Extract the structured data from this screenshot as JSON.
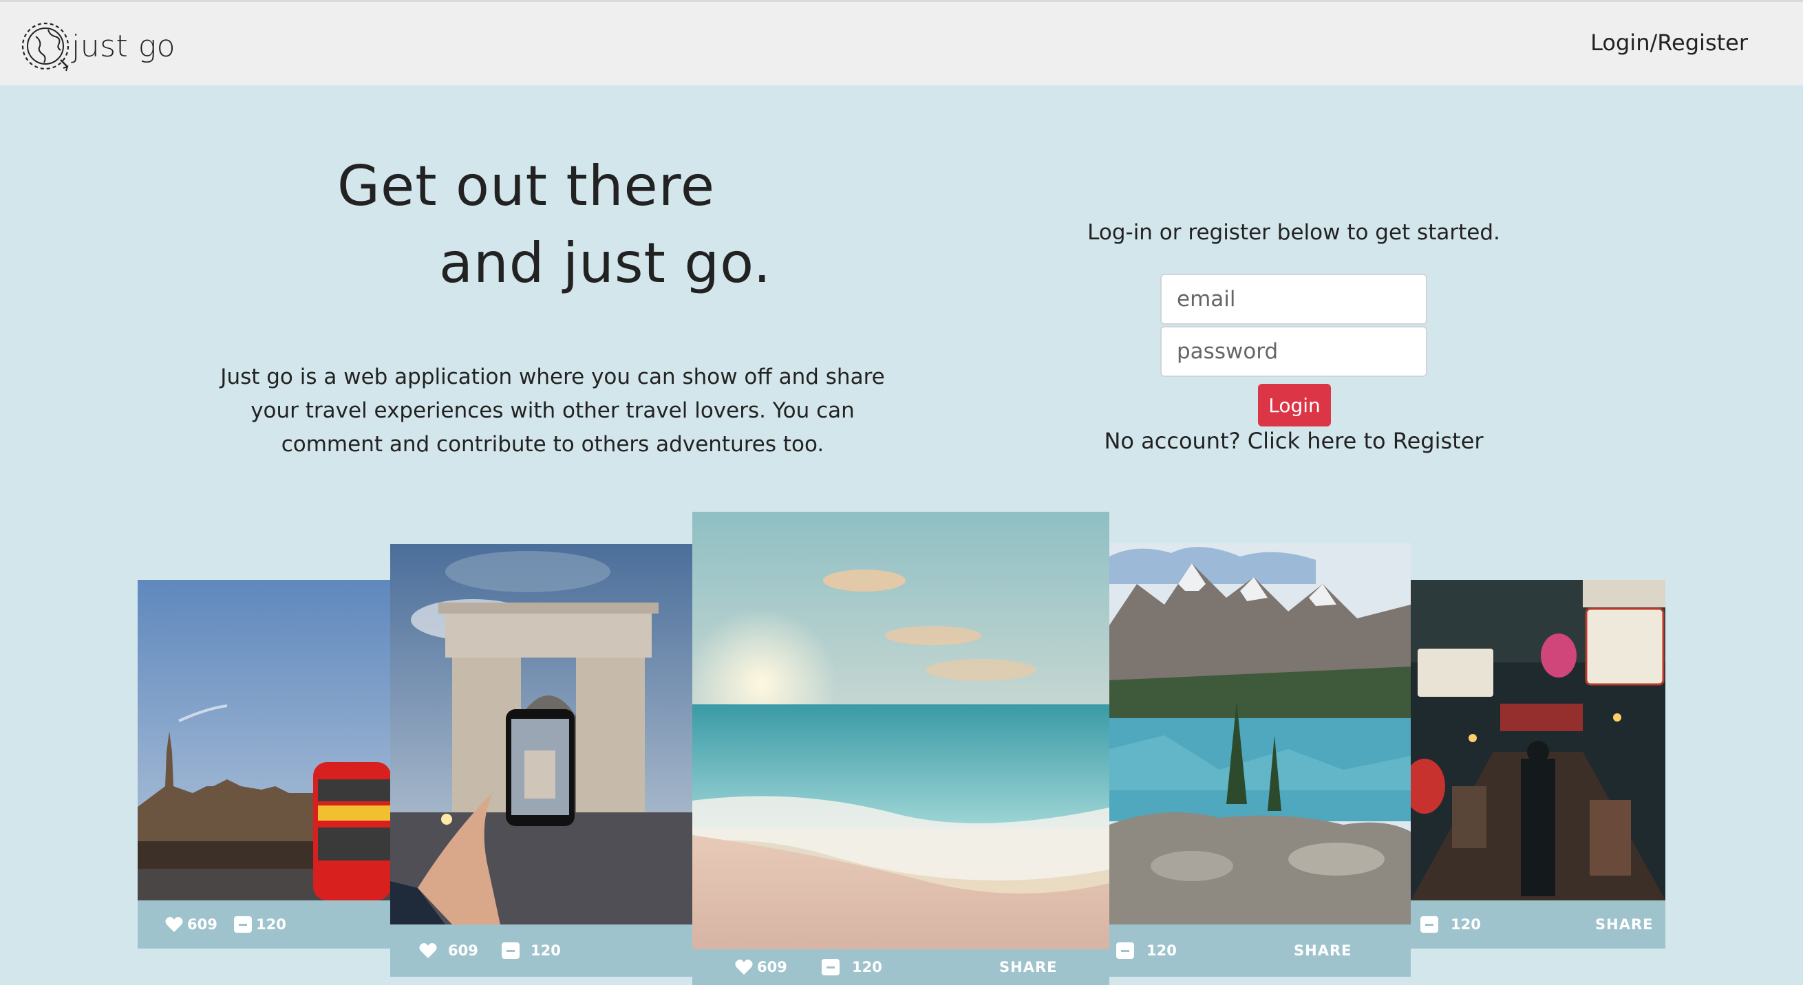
{
  "nav": {
    "brand_text": "just go",
    "login_register": "Login/Register"
  },
  "hero": {
    "title_line1": "Get out there",
    "title_line2": "and just go.",
    "description": "Just go is a web application where you can show off and share your travel experiences with other travel lovers. You can comment and contribute to others adventures too."
  },
  "login": {
    "prompt": "Log-in or register below to get started.",
    "email_placeholder": "email",
    "password_placeholder": "password",
    "button_label": "Login",
    "register_text": "No account? Click here to Register"
  },
  "cards": [
    {
      "likes": "609",
      "comments": "120"
    },
    {
      "likes": "609",
      "comments": "120"
    },
    {
      "likes": "609",
      "comments": "120",
      "share": "SHARE"
    },
    {
      "comments": "120",
      "share": "SHARE"
    },
    {
      "comments": "120",
      "share": "SHARE"
    }
  ],
  "colors": {
    "page_bg": "#d3e6ec",
    "navbar_bg": "#efefef",
    "card_bar": "#9ec3cc",
    "login_button": "#dc3545"
  }
}
